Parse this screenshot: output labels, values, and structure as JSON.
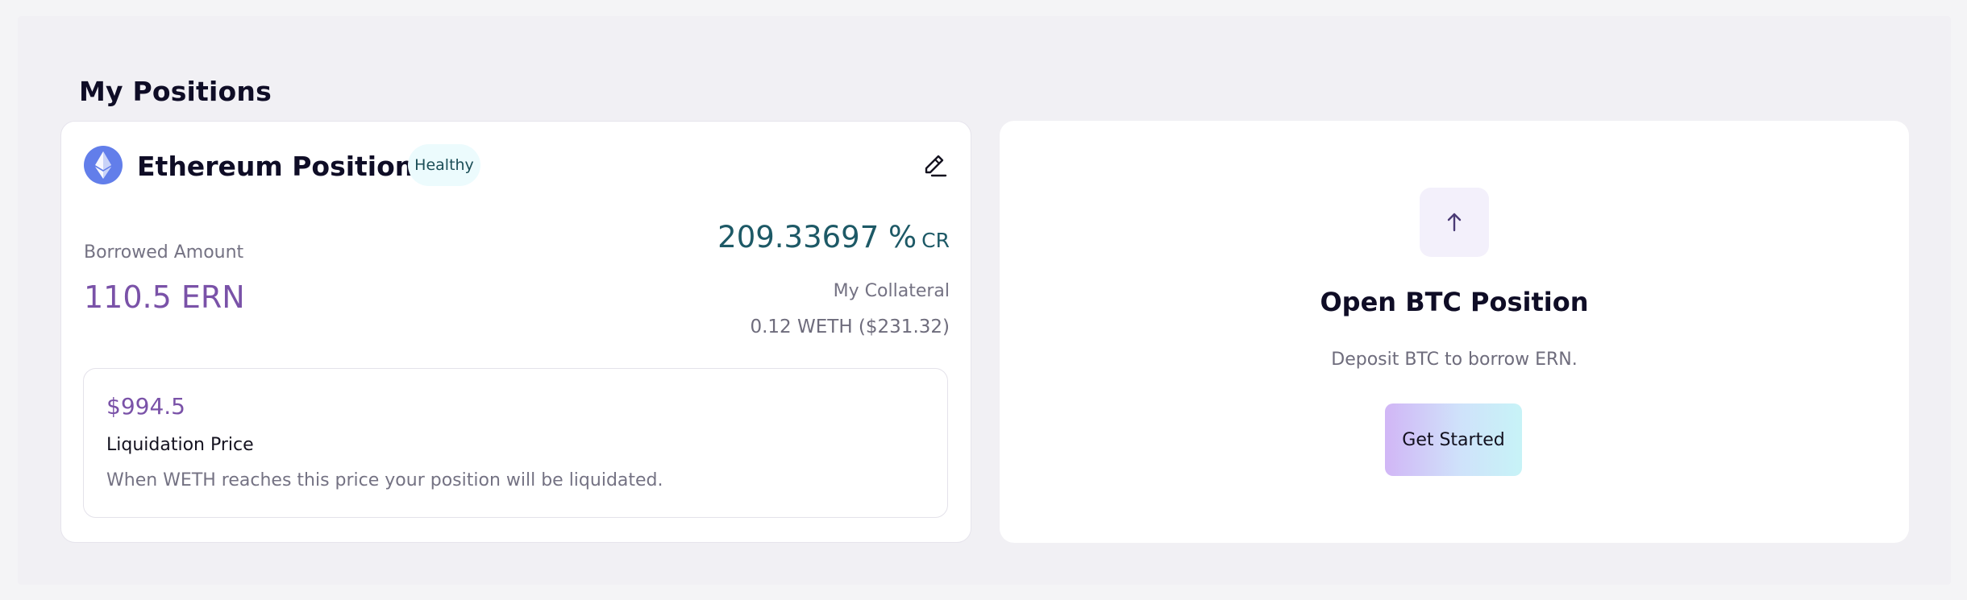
{
  "page": {
    "title": "My Positions"
  },
  "eth_position": {
    "title": "Ethereum Position",
    "status_badge": "Healthy",
    "borrowed_label": "Borrowed Amount",
    "borrowed_value": "110.5 ERN",
    "cr_value": "209.33697 %",
    "cr_unit": "CR",
    "collateral_label": "My Collateral",
    "collateral_value": "0.12 WETH ($231.32)",
    "liquidation": {
      "price": "$994.5",
      "label": "Liquidation Price",
      "description": "When WETH reaches this price your position will be liquidated."
    },
    "icons": {
      "logo": "ethereum-logo-icon",
      "edit": "edit-pencil-icon"
    }
  },
  "btc_position": {
    "title": "Open BTC Position",
    "description": "Deposit BTC to borrow ERN.",
    "cta_label": "Get Started",
    "icon": "arrow-up-icon"
  },
  "colors": {
    "accent_purple": "#7a52a8",
    "cr_teal": "#1d5966",
    "badge_bg": "#ecfbfd",
    "eth_blue": "#627eea",
    "button_gradient_start": "#d1b6f6",
    "button_gradient_end": "#c7f3f7"
  }
}
